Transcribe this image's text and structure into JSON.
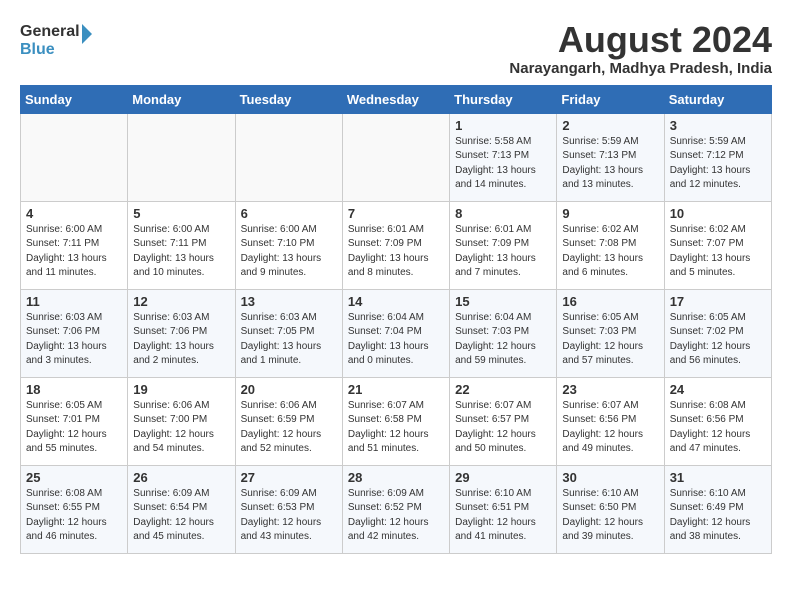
{
  "header": {
    "logo_general": "General",
    "logo_blue": "Blue",
    "title": "August 2024",
    "location": "Narayangarh, Madhya Pradesh, India"
  },
  "weekdays": [
    "Sunday",
    "Monday",
    "Tuesday",
    "Wednesday",
    "Thursday",
    "Friday",
    "Saturday"
  ],
  "weeks": [
    [
      {
        "day": "",
        "info": ""
      },
      {
        "day": "",
        "info": ""
      },
      {
        "day": "",
        "info": ""
      },
      {
        "day": "",
        "info": ""
      },
      {
        "day": "1",
        "info": "Sunrise: 5:58 AM\nSunset: 7:13 PM\nDaylight: 13 hours\nand 14 minutes."
      },
      {
        "day": "2",
        "info": "Sunrise: 5:59 AM\nSunset: 7:13 PM\nDaylight: 13 hours\nand 13 minutes."
      },
      {
        "day": "3",
        "info": "Sunrise: 5:59 AM\nSunset: 7:12 PM\nDaylight: 13 hours\nand 12 minutes."
      }
    ],
    [
      {
        "day": "4",
        "info": "Sunrise: 6:00 AM\nSunset: 7:11 PM\nDaylight: 13 hours\nand 11 minutes."
      },
      {
        "day": "5",
        "info": "Sunrise: 6:00 AM\nSunset: 7:11 PM\nDaylight: 13 hours\nand 10 minutes."
      },
      {
        "day": "6",
        "info": "Sunrise: 6:00 AM\nSunset: 7:10 PM\nDaylight: 13 hours\nand 9 minutes."
      },
      {
        "day": "7",
        "info": "Sunrise: 6:01 AM\nSunset: 7:09 PM\nDaylight: 13 hours\nand 8 minutes."
      },
      {
        "day": "8",
        "info": "Sunrise: 6:01 AM\nSunset: 7:09 PM\nDaylight: 13 hours\nand 7 minutes."
      },
      {
        "day": "9",
        "info": "Sunrise: 6:02 AM\nSunset: 7:08 PM\nDaylight: 13 hours\nand 6 minutes."
      },
      {
        "day": "10",
        "info": "Sunrise: 6:02 AM\nSunset: 7:07 PM\nDaylight: 13 hours\nand 5 minutes."
      }
    ],
    [
      {
        "day": "11",
        "info": "Sunrise: 6:03 AM\nSunset: 7:06 PM\nDaylight: 13 hours\nand 3 minutes."
      },
      {
        "day": "12",
        "info": "Sunrise: 6:03 AM\nSunset: 7:06 PM\nDaylight: 13 hours\nand 2 minutes."
      },
      {
        "day": "13",
        "info": "Sunrise: 6:03 AM\nSunset: 7:05 PM\nDaylight: 13 hours\nand 1 minute."
      },
      {
        "day": "14",
        "info": "Sunrise: 6:04 AM\nSunset: 7:04 PM\nDaylight: 13 hours\nand 0 minutes."
      },
      {
        "day": "15",
        "info": "Sunrise: 6:04 AM\nSunset: 7:03 PM\nDaylight: 12 hours\nand 59 minutes."
      },
      {
        "day": "16",
        "info": "Sunrise: 6:05 AM\nSunset: 7:03 PM\nDaylight: 12 hours\nand 57 minutes."
      },
      {
        "day": "17",
        "info": "Sunrise: 6:05 AM\nSunset: 7:02 PM\nDaylight: 12 hours\nand 56 minutes."
      }
    ],
    [
      {
        "day": "18",
        "info": "Sunrise: 6:05 AM\nSunset: 7:01 PM\nDaylight: 12 hours\nand 55 minutes."
      },
      {
        "day": "19",
        "info": "Sunrise: 6:06 AM\nSunset: 7:00 PM\nDaylight: 12 hours\nand 54 minutes."
      },
      {
        "day": "20",
        "info": "Sunrise: 6:06 AM\nSunset: 6:59 PM\nDaylight: 12 hours\nand 52 minutes."
      },
      {
        "day": "21",
        "info": "Sunrise: 6:07 AM\nSunset: 6:58 PM\nDaylight: 12 hours\nand 51 minutes."
      },
      {
        "day": "22",
        "info": "Sunrise: 6:07 AM\nSunset: 6:57 PM\nDaylight: 12 hours\nand 50 minutes."
      },
      {
        "day": "23",
        "info": "Sunrise: 6:07 AM\nSunset: 6:56 PM\nDaylight: 12 hours\nand 49 minutes."
      },
      {
        "day": "24",
        "info": "Sunrise: 6:08 AM\nSunset: 6:56 PM\nDaylight: 12 hours\nand 47 minutes."
      }
    ],
    [
      {
        "day": "25",
        "info": "Sunrise: 6:08 AM\nSunset: 6:55 PM\nDaylight: 12 hours\nand 46 minutes."
      },
      {
        "day": "26",
        "info": "Sunrise: 6:09 AM\nSunset: 6:54 PM\nDaylight: 12 hours\nand 45 minutes."
      },
      {
        "day": "27",
        "info": "Sunrise: 6:09 AM\nSunset: 6:53 PM\nDaylight: 12 hours\nand 43 minutes."
      },
      {
        "day": "28",
        "info": "Sunrise: 6:09 AM\nSunset: 6:52 PM\nDaylight: 12 hours\nand 42 minutes."
      },
      {
        "day": "29",
        "info": "Sunrise: 6:10 AM\nSunset: 6:51 PM\nDaylight: 12 hours\nand 41 minutes."
      },
      {
        "day": "30",
        "info": "Sunrise: 6:10 AM\nSunset: 6:50 PM\nDaylight: 12 hours\nand 39 minutes."
      },
      {
        "day": "31",
        "info": "Sunrise: 6:10 AM\nSunset: 6:49 PM\nDaylight: 12 hours\nand 38 minutes."
      }
    ]
  ]
}
